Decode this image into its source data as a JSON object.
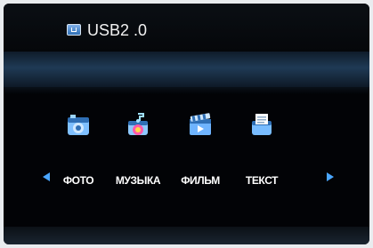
{
  "header": {
    "device_icon": "usb-drive-icon",
    "title": "USB2 .0"
  },
  "menu": {
    "left_arrow_icon": "left-arrow-icon",
    "right_arrow_icon": "right-arrow-icon",
    "items": [
      {
        "label": "ФОТО",
        "icon": "photo-icon"
      },
      {
        "label": "МУЗЫКА",
        "icon": "music-icon"
      },
      {
        "label": "ФИЛЬМ",
        "icon": "film-icon"
      },
      {
        "label": "ТЕКСТ",
        "icon": "text-icon"
      }
    ]
  },
  "colors": {
    "background": "#020306",
    "accent": "#3f8bd6",
    "text": "#ffffff"
  }
}
